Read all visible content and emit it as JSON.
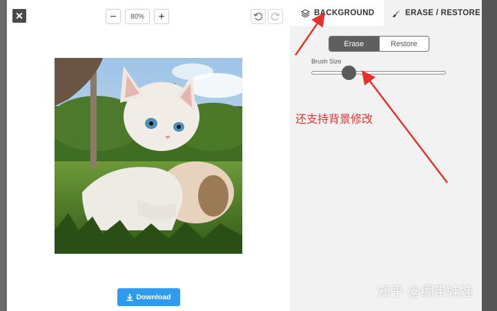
{
  "toolbar": {
    "close_glyph": "✕",
    "zoom_out": "−",
    "zoom_level": "80%",
    "zoom_in": "+"
  },
  "tabs": {
    "background": "BACKGROUND",
    "erase_restore": "ERASE / RESTORE"
  },
  "panel": {
    "erase_label": "Erase",
    "restore_label": "Restore",
    "active_mode": "Erase",
    "brush_size_label": "Brush Size",
    "brush_size_level": 0.28
  },
  "annotation": {
    "text": "还支持背景修改",
    "color": "#e03232"
  },
  "download": {
    "label": "Download"
  },
  "watermark": {
    "text": "知乎 @绷带娃娃"
  },
  "colors": {
    "accent": "#2f9bf0",
    "panel_bg": "#f2f2f2",
    "active_segment": "#5f5f5f"
  }
}
